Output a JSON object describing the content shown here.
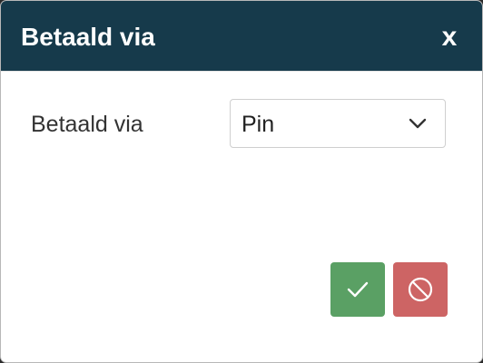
{
  "dialog": {
    "title": "Betaald via",
    "close_label": "x"
  },
  "form": {
    "field_label": "Betaald via",
    "selected_value": "Pin"
  },
  "actions": {
    "confirm_icon": "checkmark-icon",
    "cancel_icon": "no-entry-icon"
  },
  "colors": {
    "header_bg": "#163a4b",
    "confirm_bg": "#5aa064",
    "cancel_bg": "#cd6464"
  }
}
